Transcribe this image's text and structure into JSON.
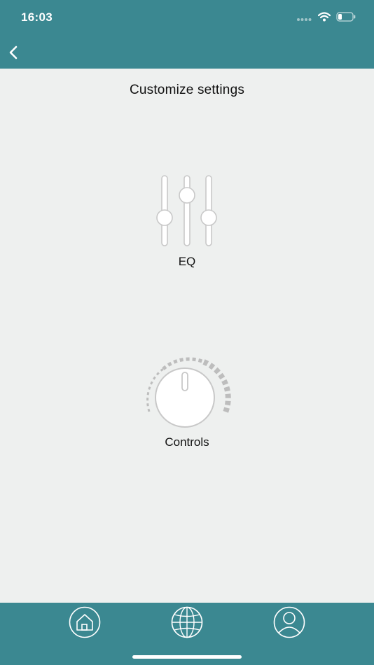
{
  "status_bar": {
    "time": "16:03",
    "icons": [
      "signal-icon",
      "wifi-icon",
      "battery-icon"
    ]
  },
  "nav": {
    "back_icon": "chevron-left-icon"
  },
  "page": {
    "title": "Customize settings"
  },
  "tiles": [
    {
      "label": "EQ",
      "icon": "equalizer-sliders-icon"
    },
    {
      "label": "Controls",
      "icon": "knob-dial-icon"
    }
  ],
  "tab_bar": {
    "tabs": [
      {
        "icon": "home-icon"
      },
      {
        "icon": "globe-icon"
      },
      {
        "icon": "profile-icon"
      }
    ]
  },
  "colors": {
    "header_bg": "#3b8891",
    "content_bg": "#eef0ef",
    "icon_stroke": "#c8c8c8",
    "text": "#111111"
  }
}
